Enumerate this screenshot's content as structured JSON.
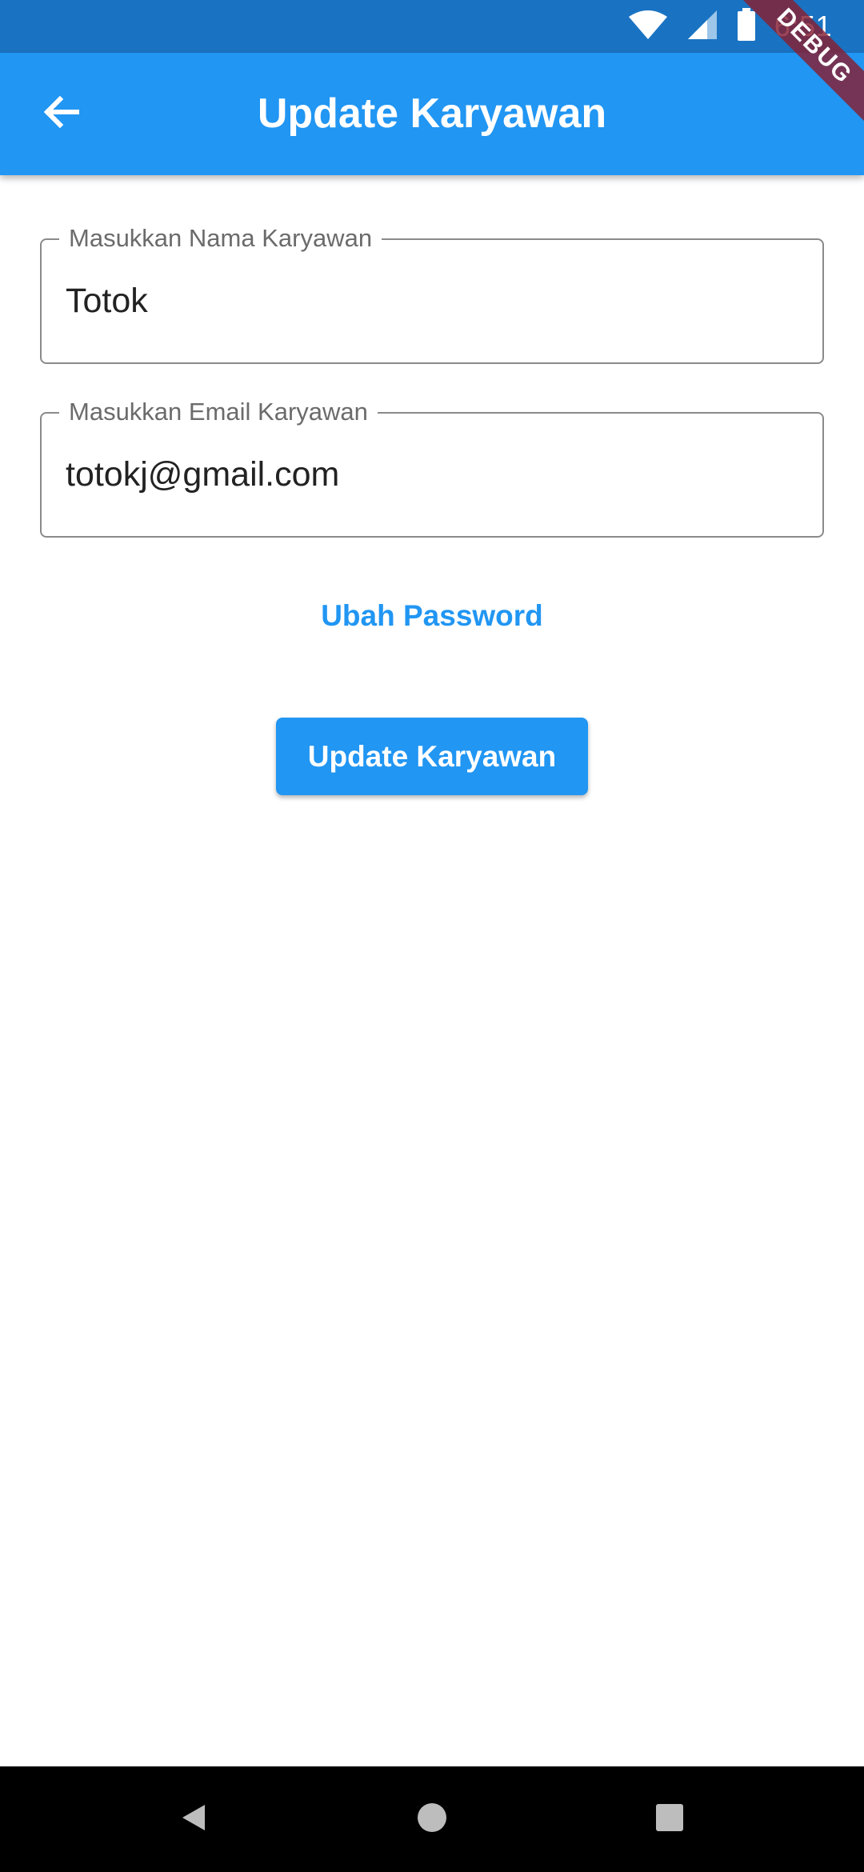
{
  "status_bar": {
    "time": "6:51",
    "background": "#1a73c2",
    "icons": [
      "wifi-icon",
      "cellular-signal-icon",
      "battery-icon"
    ]
  },
  "app_bar": {
    "title": "Update Karyawan",
    "back_icon": "arrow-back-icon",
    "background": "#2196f3"
  },
  "debug_banner": {
    "label": "DEBUG",
    "color": "#881e32"
  },
  "form": {
    "name_field": {
      "label": "Masukkan Nama Karyawan",
      "value": "Totok"
    },
    "email_field": {
      "label": "Masukkan Email Karyawan",
      "value": "totokj@gmail.com"
    },
    "change_password_label": "Ubah Password",
    "submit_label": "Update Karyawan",
    "accent_color": "#2196f3"
  },
  "nav_bar": {
    "icons": [
      "nav-back-icon",
      "nav-home-icon",
      "nav-recent-icon"
    ]
  }
}
